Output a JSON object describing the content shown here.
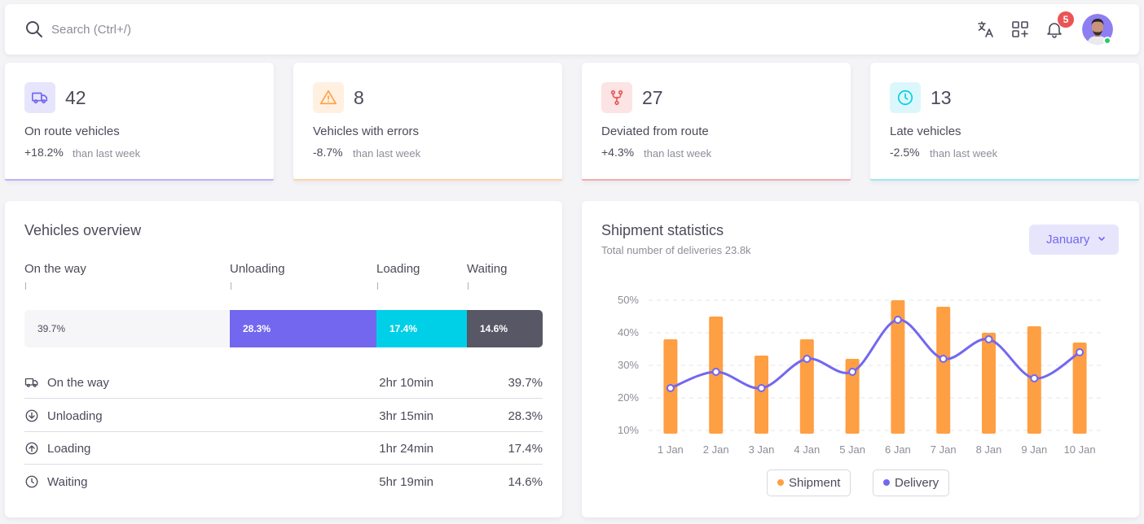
{
  "colors": {
    "primary": "#7367f0",
    "warning": "#ff9f43",
    "danger": "#ea5455",
    "info": "#00cfe8",
    "dark": "#575766",
    "muted_bar": "#f6f6f8"
  },
  "topbar": {
    "search_placeholder": "Search (Ctrl+/)",
    "icons": [
      "translate-icon",
      "grid-plus-icon",
      "bell-icon"
    ],
    "notifications_count": "5"
  },
  "stats": [
    {
      "value": "42",
      "label": "On route vehicles",
      "change": "+18.2%",
      "sub": "than last week",
      "icon": "truck-icon",
      "color": "#7367f0"
    },
    {
      "value": "8",
      "label": "Vehicles with errors",
      "change": "-8.7%",
      "sub": "than last week",
      "icon": "alert-triangle-icon",
      "color": "#ff9f43"
    },
    {
      "value": "27",
      "label": "Deviated from route",
      "change": "+4.3%",
      "sub": "than last week",
      "icon": "git-fork-icon",
      "color": "#ea5455"
    },
    {
      "value": "13",
      "label": "Late vehicles",
      "change": "-2.5%",
      "sub": "than last week",
      "icon": "clock-icon",
      "color": "#00cfe8"
    }
  ],
  "overview": {
    "title": "Vehicles overview",
    "segments": [
      {
        "label": "On the way",
        "percent": 39.7,
        "bar_text": "39.7%"
      },
      {
        "label": "Unloading",
        "percent": 28.3,
        "bar_text": "28.3%"
      },
      {
        "label": "Loading",
        "percent": 17.4,
        "bar_text": "17.4%"
      },
      {
        "label": "Waiting",
        "percent": 14.6,
        "bar_text": "14.6%"
      }
    ],
    "rows": [
      {
        "label": "On the way",
        "time": "2hr 10min",
        "pct": "39.7%",
        "icon": "truck-icon"
      },
      {
        "label": "Unloading",
        "time": "3hr 15min",
        "pct": "28.3%",
        "icon": "arrow-down-circle-icon"
      },
      {
        "label": "Loading",
        "time": "1hr 24min",
        "pct": "17.4%",
        "icon": "arrow-up-circle-icon"
      },
      {
        "label": "Waiting",
        "time": "5hr 19min",
        "pct": "14.6%",
        "icon": "clock-icon"
      }
    ]
  },
  "shipment": {
    "title": "Shipment statistics",
    "subtitle": "Total number of deliveries 23.8k",
    "month_button": "January",
    "legend": {
      "shipment": "Shipment",
      "delivery": "Delivery"
    }
  },
  "chart_data": {
    "type": "bar",
    "categories": [
      "1 Jan",
      "2 Jan",
      "3 Jan",
      "4 Jan",
      "5 Jan",
      "6 Jan",
      "7 Jan",
      "8 Jan",
      "9 Jan",
      "10 Jan"
    ],
    "series": [
      {
        "name": "Shipment",
        "type": "bar",
        "color": "#ff9f43",
        "values": [
          38,
          45,
          33,
          38,
          32,
          50,
          48,
          40,
          42,
          37
        ]
      },
      {
        "name": "Delivery",
        "type": "line",
        "color": "#7367f0",
        "values": [
          23,
          28,
          23,
          32,
          28,
          44,
          32,
          38,
          26,
          34
        ]
      }
    ],
    "yticks": [
      "10%",
      "20%",
      "30%",
      "40%",
      "50%"
    ],
    "ylim": [
      10,
      50
    ],
    "grid": true,
    "legend_position": "bottom"
  }
}
